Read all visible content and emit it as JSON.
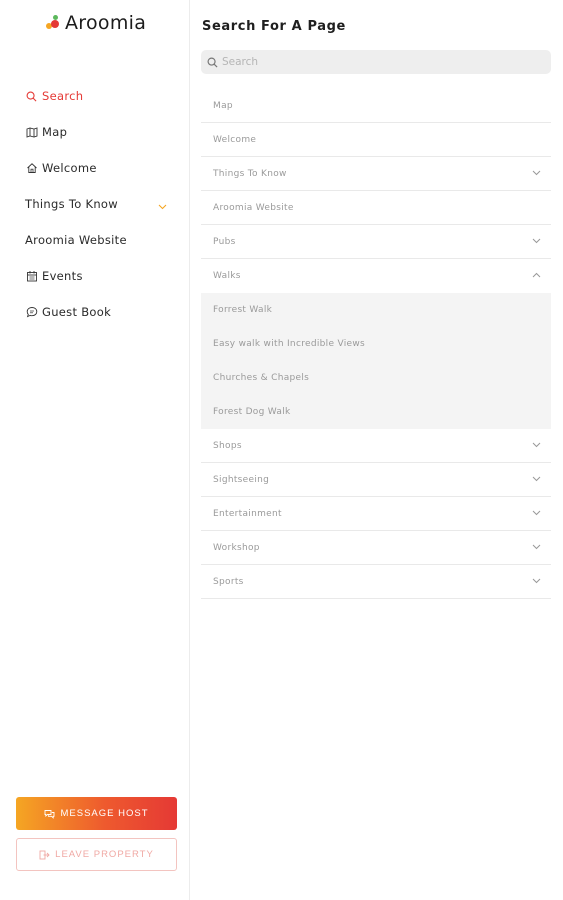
{
  "app": {
    "logo_text": "Aroomia",
    "accent": "#e53935",
    "brand_orange": "#f5a623"
  },
  "sidebar": {
    "items": [
      {
        "label": "Search",
        "icon": "search-icon",
        "active": true
      },
      {
        "label": "Map",
        "icon": "map-icon"
      },
      {
        "label": "Welcome",
        "icon": "home-icon"
      },
      {
        "label": "Things To Know",
        "icon": null,
        "has_chevron": true
      },
      {
        "label": "Aroomia Website",
        "icon": null
      },
      {
        "label": "Events",
        "icon": "calendar-icon"
      },
      {
        "label": "Guest Book",
        "icon": "chat-icon"
      }
    ],
    "message_host_label": "MESSAGE HOST",
    "leave_property_label": "LEAVE PROPERTY"
  },
  "main": {
    "title": "Search For A Page",
    "search_placeholder": "Search",
    "pages": [
      {
        "label": "Map",
        "expandable": false
      },
      {
        "label": "Welcome",
        "expandable": false
      },
      {
        "label": "Things To Know",
        "expandable": true,
        "expanded": false
      },
      {
        "label": "Aroomia Website",
        "expandable": false
      },
      {
        "label": "Pubs",
        "expandable": true,
        "expanded": false
      },
      {
        "label": "Walks",
        "expandable": true,
        "expanded": true,
        "children": [
          "Forrest Walk",
          "Easy walk with Incredible Views",
          "Churches & Chapels",
          "Forest Dog Walk"
        ]
      },
      {
        "label": "Shops",
        "expandable": true,
        "expanded": false
      },
      {
        "label": "Sightseeing",
        "expandable": true,
        "expanded": false
      },
      {
        "label": "Entertainment",
        "expandable": true,
        "expanded": false
      },
      {
        "label": "Workshop",
        "expandable": true,
        "expanded": false
      },
      {
        "label": "Sports",
        "expandable": true,
        "expanded": false
      }
    ]
  }
}
